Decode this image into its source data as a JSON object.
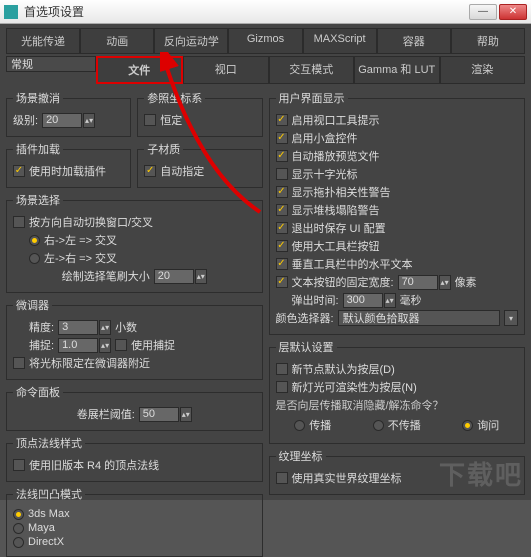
{
  "window": {
    "title": "首选项设置"
  },
  "winbtns": {
    "min": "—",
    "close": "✕"
  },
  "tabs_row1": [
    "光能传递",
    "动画",
    "反向运动学",
    "Gizmos",
    "MAXScript",
    "容器",
    "帮助"
  ],
  "tabs_row2": [
    "常规",
    "文件",
    "视口",
    "交互模式",
    "Gamma 和 LUT",
    "渲染"
  ],
  "left": {
    "undo": {
      "legend": "场景撤消",
      "level_label": "级别:",
      "level": "20"
    },
    "coord": {
      "legend": "参照坐标系",
      "opt": "恒定"
    },
    "plugin": {
      "legend": "插件加载",
      "opt": "使用时加载插件"
    },
    "submat": {
      "legend": "子材质",
      "opt": "自动指定"
    },
    "scenesel": {
      "legend": "场景选择",
      "opt1": "按方向自动切换窗口/交叉",
      "r1": "右->左 => 交叉",
      "r2": "左->右 => 交叉",
      "brush_label": "绘制选择笔刷大小",
      "brush": "20"
    },
    "spinner": {
      "legend": "微调器",
      "prec_label": "精度:",
      "prec": "3",
      "prec_unit": "小数",
      "snap_label": "捕捉:",
      "snap": "1.0",
      "snap_opt": "使用捕捉",
      "lock": "将光标限定在微调器附近"
    },
    "cmd": {
      "legend": "命令面板",
      "rollup_label": "卷展栏阈值:",
      "rollup": "50"
    },
    "normal": {
      "legend": "顶点法线样式",
      "opt": "使用旧版本 R4 的顶点法线"
    },
    "tess": {
      "legend": "法线凹凸模式",
      "r1": "3ds Max",
      "r2": "Maya",
      "r3": "DirectX"
    }
  },
  "right": {
    "ui": {
      "legend": "用户界面显示",
      "o1": "启用视口工具提示",
      "o2": "启用小盒控件",
      "o3": "自动播放预览文件",
      "o4": "显示十字光标",
      "o5": "显示拖扑相关性警告",
      "o6": "显示堆栈塌陷警告",
      "o7": "退出时保存 UI 配置",
      "o8": "使用大工具栏按钮",
      "o9": "垂直工具栏中的水平文本",
      "o10": "文本按钮的固定宽度:",
      "o10v": "70",
      "o10u": "像素",
      "fly_label": "弹出时间:",
      "fly": "300",
      "fly_u": "毫秒",
      "picker_label": "颜色选择器:",
      "picker": "默认颜色拾取器"
    },
    "layer": {
      "legend": "层默认设置",
      "o1": "新节点默认为按层(D)",
      "o2": "新灯光可渲染性为按层(N)",
      "q": "是否向层传播取消隐藏/解冻命令？",
      "r1": "传播",
      "r2": "不传播",
      "r3": "询问"
    },
    "tex": {
      "legend": "纹理坐标",
      "o": "使用真实世界纹理坐标"
    }
  },
  "watermark": "下载吧"
}
